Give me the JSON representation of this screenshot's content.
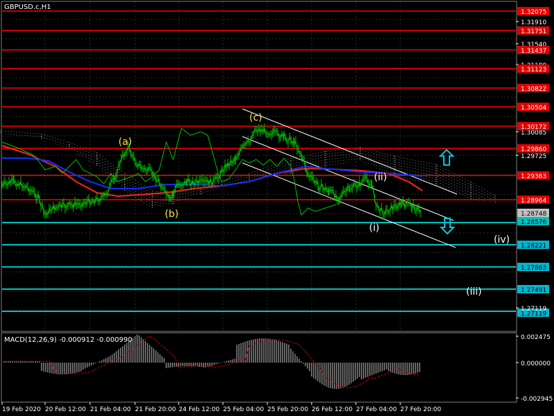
{
  "symbol_title": "GBPUSD.c,H1",
  "macd_title": "MACD(12,26,9) -0.000912 -0.000990",
  "colors": {
    "background": "#000000",
    "grid": "#2b2b2b",
    "resistance_line": "#ff0000",
    "support_line": "#00ffff",
    "price_line": "#00c000",
    "wave_label_yellow": "#ffe34d",
    "wave_label_white": "#ffffff",
    "ma_red": "#ff2020",
    "ma_blue": "#1030ff",
    "macd_hist": "#c8c8c8",
    "macd_signal": "#d00000",
    "arrow": "#00c8e0"
  },
  "price_axis": {
    "plain_ticks": [
      "1.31910",
      "1.31540",
      "1.31180",
      "1.30085",
      "1.29725"
    ],
    "resistance_levels": [
      "1.32075",
      "1.31751",
      "1.31437",
      "1.31123",
      "1.30822",
      "1.30504",
      "1.30172",
      "1.29860",
      "1.29363",
      "1.28964"
    ],
    "current_prices": [
      "1.28748",
      "1.28576"
    ],
    "support_levels": [
      "1.28576",
      "1.28221",
      "1.27863",
      "1.27491",
      "1.27119"
    ],
    "support_plain_tick": "1.27119"
  },
  "macd_axis": {
    "ticks": [
      "0.002475",
      "0.000000",
      "-0.002945"
    ]
  },
  "time_axis": {
    "labels": [
      "19 Feb 2020",
      "20 Feb 12:00",
      "21 Feb 04:00",
      "21 Feb 20:00",
      "24 Feb 12:00",
      "25 Feb 04:00",
      "25 Feb 20:00",
      "26 Feb 12:00",
      "27 Feb 04:00",
      "27 Feb 20:00"
    ]
  },
  "wave_labels": {
    "a": "(a)",
    "b": "(b)",
    "c": "(c)",
    "i": "(i)",
    "ii": "(ii)",
    "iii": "(iii)",
    "iv": "(iv)"
  },
  "arrows": {
    "up": "up-arrow",
    "down": "down-arrow"
  }
}
